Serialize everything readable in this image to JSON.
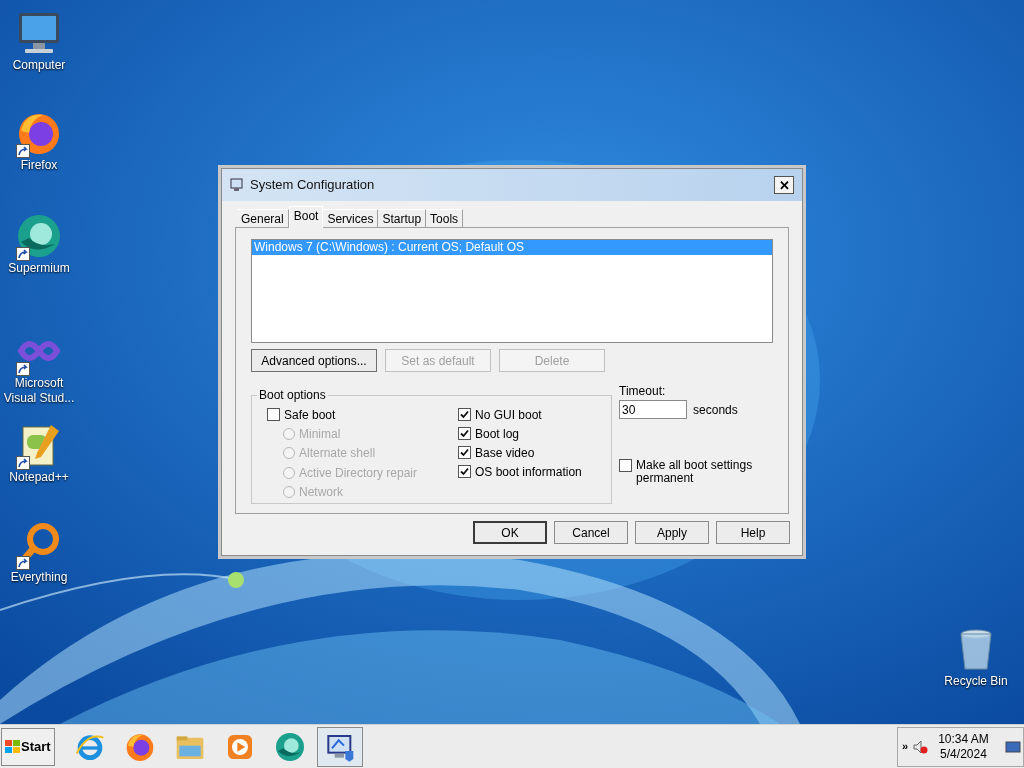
{
  "desktop_icons": [
    {
      "label": "Computer",
      "kind": "computer",
      "shortcut": false
    },
    {
      "label": "Firefox",
      "kind": "firefox",
      "shortcut": true
    },
    {
      "label": "Supermium",
      "kind": "supermium",
      "shortcut": true
    },
    {
      "label": "Microsoft Visual Stud...",
      "kind": "vs",
      "shortcut": true
    },
    {
      "label": "Notepad++",
      "kind": "notepad",
      "shortcut": true
    },
    {
      "label": "Everything",
      "kind": "everything",
      "shortcut": true
    },
    {
      "label": "Recycle Bin",
      "kind": "recycle",
      "shortcut": false
    }
  ],
  "window": {
    "title": "System Configuration",
    "close": "✕",
    "tabs": [
      {
        "label": "General",
        "selected": false
      },
      {
        "label": "Boot",
        "selected": true
      },
      {
        "label": "Services",
        "selected": false
      },
      {
        "label": "Startup",
        "selected": false
      },
      {
        "label": "Tools",
        "selected": false
      }
    ],
    "boot_entries": [
      {
        "label": "Windows 7 (C:\\Windows) : Current OS; Default OS",
        "selected": true
      }
    ],
    "entry_buttons": [
      {
        "label": "Advanced options...",
        "disabled": false
      },
      {
        "label": "Set as default",
        "disabled": true
      },
      {
        "label": "Delete",
        "disabled": true
      }
    ],
    "boot_options": {
      "title": "Boot options",
      "safe_boot": {
        "label": "Safe boot",
        "checked": false
      },
      "safe_modes": [
        {
          "label": "Minimal",
          "selected": false,
          "disabled": true
        },
        {
          "label": "Alternate shell",
          "selected": false,
          "disabled": true
        },
        {
          "label": "Active Directory repair",
          "selected": false,
          "disabled": true
        },
        {
          "label": "Network",
          "selected": false,
          "disabled": true
        }
      ],
      "flags": [
        {
          "label": "No GUI boot",
          "checked": true
        },
        {
          "label": "Boot log",
          "checked": true
        },
        {
          "label": "Base video",
          "checked": true
        },
        {
          "label": "OS boot information",
          "checked": true
        }
      ]
    },
    "timeout": {
      "label": "Timeout:",
      "value": "30",
      "unit": "seconds"
    },
    "permanent": {
      "label": "Make all boot settings permanent",
      "checked": false
    },
    "buttons": [
      {
        "label": "OK",
        "default": true
      },
      {
        "label": "Cancel",
        "default": false
      },
      {
        "label": "Apply",
        "default": false
      },
      {
        "label": "Help",
        "default": false
      }
    ]
  },
  "taskbar": {
    "start": "Start",
    "apps": [
      {
        "kind": "ie",
        "active": false
      },
      {
        "kind": "firefox",
        "active": false
      },
      {
        "kind": "explorer",
        "active": false
      },
      {
        "kind": "media",
        "active": false
      },
      {
        "kind": "supermium",
        "active": false
      },
      {
        "kind": "msconfig",
        "active": true
      }
    ],
    "tray": {
      "chevron": "»",
      "time": "10:34 AM",
      "date": "5/4/2024"
    }
  }
}
